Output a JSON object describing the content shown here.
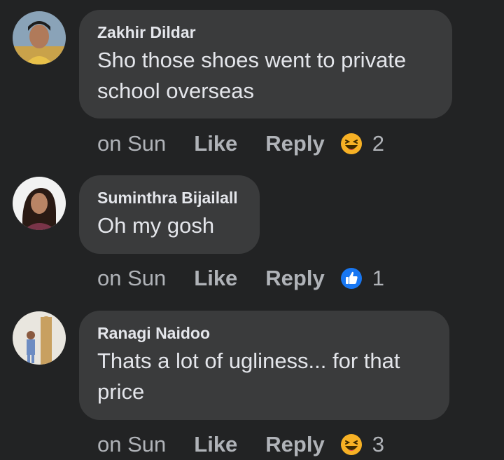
{
  "comments": [
    {
      "author": "Zakhir Dildar",
      "text_line1": "Sho those shoes went to private",
      "text_line2": "school overseas",
      "time": "on Sun",
      "like_label": "Like",
      "reply_label": "Reply",
      "reaction_icon": "haha-icon",
      "reaction_count": "2"
    },
    {
      "author": "Suminthra Bijailall",
      "text_line1": "Oh my gosh",
      "time": "on Sun",
      "like_label": "Like",
      "reply_label": "Reply",
      "reaction_icon": "like-thumb-icon",
      "reaction_count": "1"
    },
    {
      "author": "Ranagi Naidoo",
      "text_line1": "Thats a lot of ugliness... for that",
      "text_line2": "price",
      "time": "on Sun",
      "like_label": "Like",
      "reply_label": "Reply",
      "reaction_icon": "haha-icon",
      "reaction_count": "3"
    }
  ],
  "colors": {
    "background": "#222324",
    "bubble": "#3a3b3c",
    "primary_text": "#e4e6eb",
    "secondary_text": "#b0b3b8",
    "like_blue": "#1877f2",
    "haha_yellow": "#f7b125"
  }
}
